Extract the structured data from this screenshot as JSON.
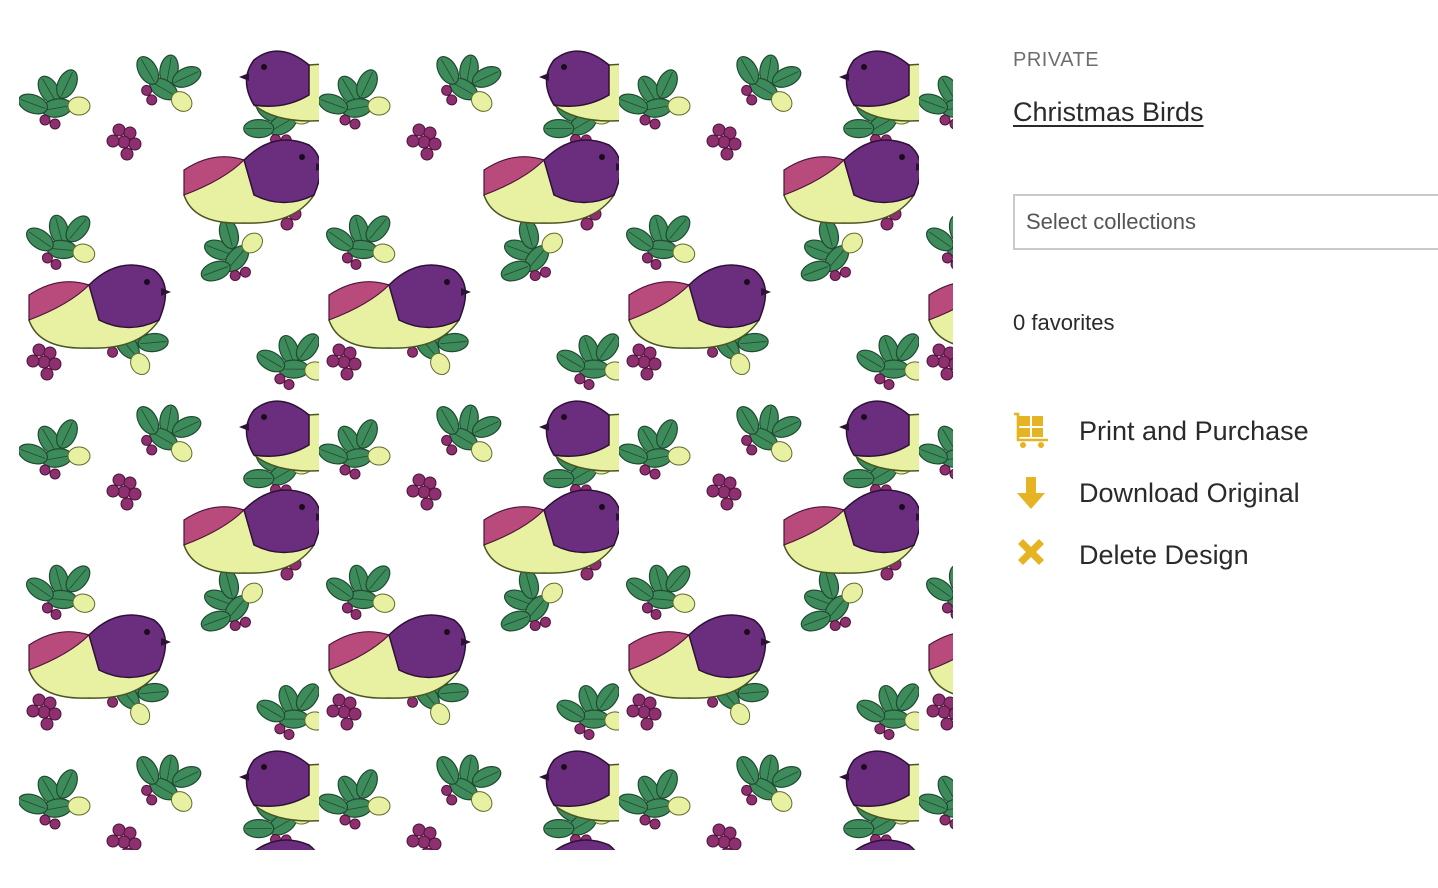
{
  "design": {
    "image_alt": "Christmas Birds pattern",
    "privacy_label": "PRIVATE",
    "title": "Christmas Birds"
  },
  "collections": {
    "placeholder": "Select collections"
  },
  "favorites": {
    "text": "0 favorites"
  },
  "actions": [
    {
      "label": "Print and Purchase",
      "icon": "cart-icon"
    },
    {
      "label": "Download Original",
      "icon": "download-arrow-icon"
    },
    {
      "label": "Delete Design",
      "icon": "delete-x-icon"
    }
  ],
  "colors": {
    "accent": "#e6b422",
    "bird_purple": "#6b2d7e",
    "bird_yellow": "#e8f0a2",
    "bird_pink": "#b84a7c",
    "leaf_green": "#3d8a5a",
    "berry": "#8e2f6f"
  }
}
